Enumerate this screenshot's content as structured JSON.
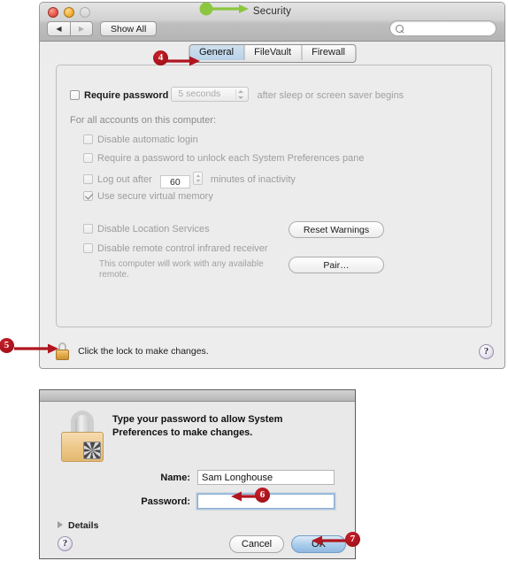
{
  "window": {
    "title": "Security",
    "traffic_lights": [
      "close",
      "minimize",
      "zoom"
    ],
    "nav_back": "◀",
    "nav_forward": "▶",
    "show_all_label": "Show All",
    "search_placeholder": ""
  },
  "tabs": [
    {
      "label": "General",
      "active": true
    },
    {
      "label": "FileVault",
      "active": false
    },
    {
      "label": "Firewall",
      "active": false
    }
  ],
  "general": {
    "require_password": {
      "label": "Require password",
      "checked": false,
      "popup_value": "5 seconds",
      "suffix": "after sleep or screen saver begins"
    },
    "section_header": "For all accounts on this computer:",
    "options": [
      {
        "label": "Disable automatic login",
        "checked": false,
        "dim": true
      },
      {
        "label": "Require a password to unlock each System Preferences pane",
        "checked": false,
        "dim": true
      },
      {
        "label": "Log out after",
        "checked": false,
        "dim": true,
        "field_value": "60",
        "suffix": "minutes of inactivity"
      },
      {
        "label": "Use secure virtual memory",
        "checked": true,
        "dim": true
      }
    ],
    "location": {
      "label": "Disable Location Services",
      "checked": false,
      "dim": true
    },
    "infrared": {
      "label": "Disable remote control infrared receiver",
      "checked": false,
      "dim": true
    },
    "infrared_note": "This computer will work with any available remote.",
    "reset_warnings_label": "Reset Warnings",
    "pair_label": "Pair…"
  },
  "footer": {
    "lock_message": "Click the lock to make changes.",
    "help_label": "?"
  },
  "dialog": {
    "heading": "Type your password to allow System Preferences to make changes.",
    "name_label": "Name:",
    "name_value": "Sam Longhouse",
    "password_label": "Password:",
    "password_value": "",
    "details_label": "Details",
    "help_label": "?",
    "cancel_label": "Cancel",
    "ok_label": "OK"
  },
  "callouts": [
    {
      "id": "green",
      "label": "",
      "color": "#8cc63f"
    },
    {
      "id": "four",
      "label": "4",
      "color": "#a8131c"
    },
    {
      "id": "five",
      "label": "5",
      "color": "#a8131c"
    },
    {
      "id": "six",
      "label": "6",
      "color": "#a8131c"
    },
    {
      "id": "seven",
      "label": "7",
      "color": "#a8131c"
    }
  ]
}
